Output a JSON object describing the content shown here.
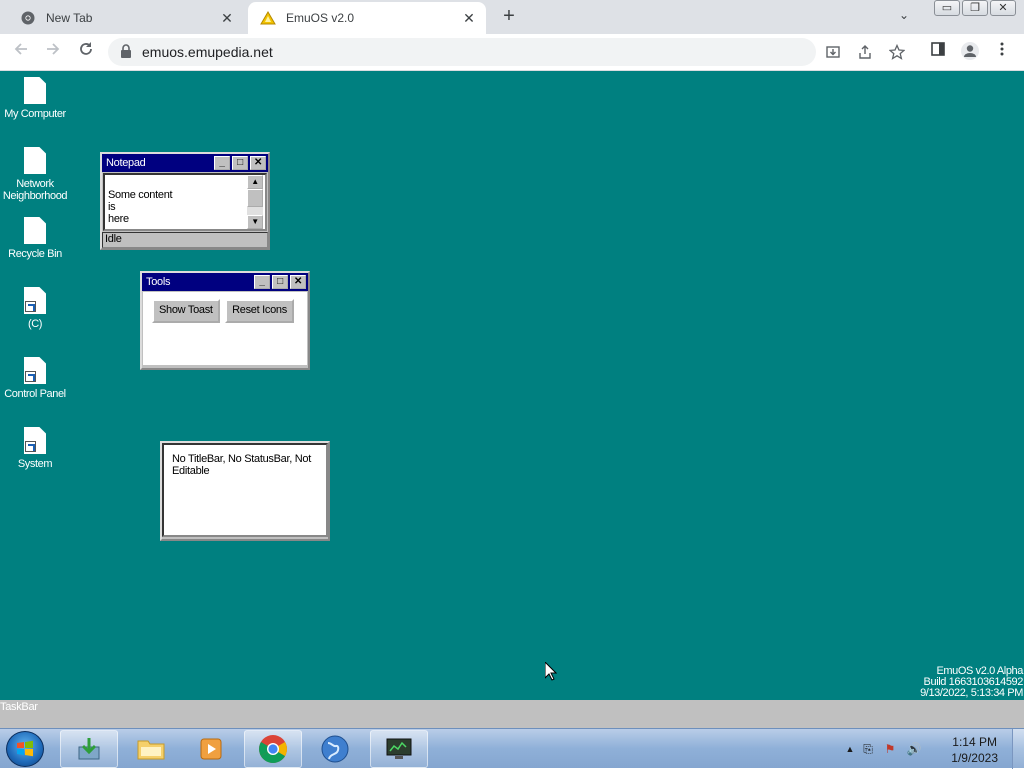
{
  "browser": {
    "tabs": [
      {
        "title": "New Tab",
        "active": false
      },
      {
        "title": "EmuOS v2.0",
        "active": true
      }
    ],
    "close_glyph": "✕",
    "new_tab_glyph": "+",
    "tab_search_glyph": "⌄",
    "window_controls": [
      "▭",
      "❐",
      "✕"
    ],
    "address": "emuos.emupedia.net",
    "icons": {
      "back": "back-arrow-icon",
      "forward": "forward-arrow-icon",
      "reload": "reload-icon",
      "lock": "lock-icon",
      "install": "install-app-icon",
      "share": "share-icon",
      "bookmark": "star-icon",
      "sidepanel": "side-panel-icon",
      "profile": "profile-icon",
      "menu": "kebab-menu-icon"
    }
  },
  "desktop": {
    "background": "#008080",
    "icons": [
      {
        "label": "My Computer",
        "shortcut": false
      },
      {
        "label": "Network Neighborhood",
        "shortcut": false
      },
      {
        "label": "Recycle Bin",
        "shortcut": false
      },
      {
        "label": "(C)",
        "shortcut": true
      },
      {
        "label": "Control Panel",
        "shortcut": true
      },
      {
        "label": "System",
        "shortcut": true
      }
    ],
    "notepad": {
      "title": "Notepad",
      "lines": [
        "Some content",
        "is",
        "here"
      ],
      "status": "Idle"
    },
    "tools": {
      "title": "Tools",
      "buttons": [
        "Show Toast",
        "Reset Icons"
      ]
    },
    "plain_window": {
      "text": "No TitleBar, No StatusBar, Not Editable"
    },
    "version": [
      "EmuOS v2.0 Alpha",
      "Build 1663103614592",
      "9/13/2022, 5:13:34 PM"
    ]
  },
  "emu_taskbar": {
    "label": "TaskBar"
  },
  "win7_taskbar": {
    "apps": [
      "download-manager-icon",
      "file-explorer-icon",
      "media-player-icon",
      "chrome-icon",
      "globe-icon",
      "monitor-icon"
    ],
    "tray_glyphs": [
      "▲",
      "⎘",
      "⚑",
      "🔊"
    ],
    "time": "1:14 PM",
    "date": "1/9/2023"
  }
}
